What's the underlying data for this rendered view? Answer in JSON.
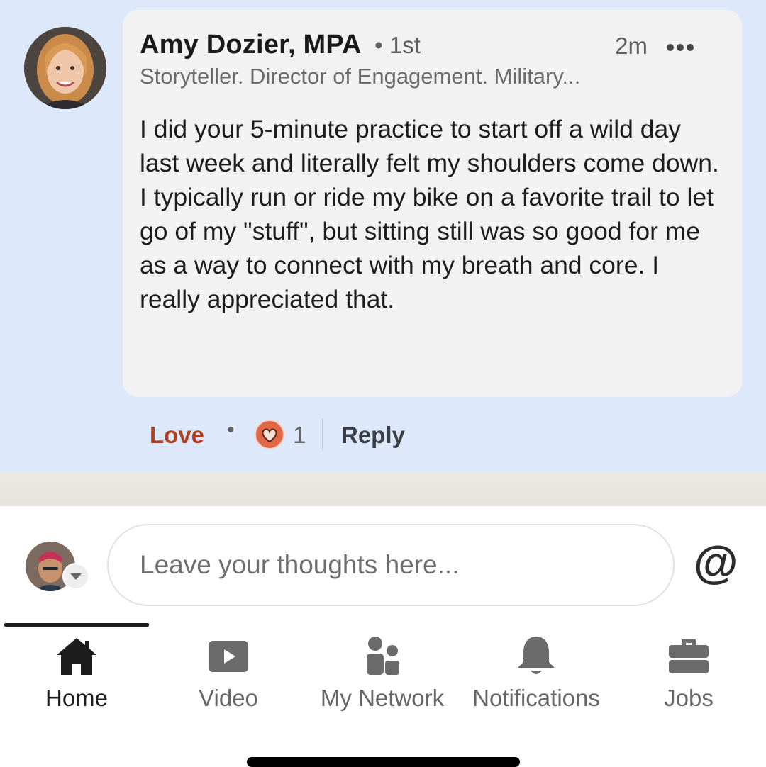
{
  "comment": {
    "author_name": "Amy Dozier, MPA",
    "degree": "• 1st",
    "time": "2m",
    "more_icon": "more-horizontal-icon",
    "headline": "Storyteller. Director of Engagement. Military...",
    "text": "I did your 5-minute practice to start off a wild day last week and literally felt my shoulders come down. I typically run or ride my bike on a favorite trail to let go of my \"stuff\", but sitting still was so good for me as a way to connect with my breath and core. I really appreciated that."
  },
  "actions": {
    "reaction_label": "Love",
    "separator": "•",
    "reaction_icon": "heart-reaction-icon",
    "reaction_count": "1",
    "reply_label": "Reply"
  },
  "composer": {
    "placeholder": "Leave your thoughts here...",
    "mention_symbol": "@"
  },
  "nav": {
    "items": [
      {
        "label": "Home",
        "icon": "home-icon",
        "active": true
      },
      {
        "label": "Video",
        "icon": "video-icon",
        "active": false
      },
      {
        "label": "My Network",
        "icon": "network-icon",
        "active": false
      },
      {
        "label": "Notifications",
        "icon": "bell-icon",
        "active": false
      },
      {
        "label": "Jobs",
        "icon": "briefcase-icon",
        "active": false
      }
    ]
  },
  "colors": {
    "comment_background": "#dde9fa",
    "bubble_background": "#f2f2f2",
    "love_red": "#b24020",
    "reaction_orange": "#e06847"
  }
}
